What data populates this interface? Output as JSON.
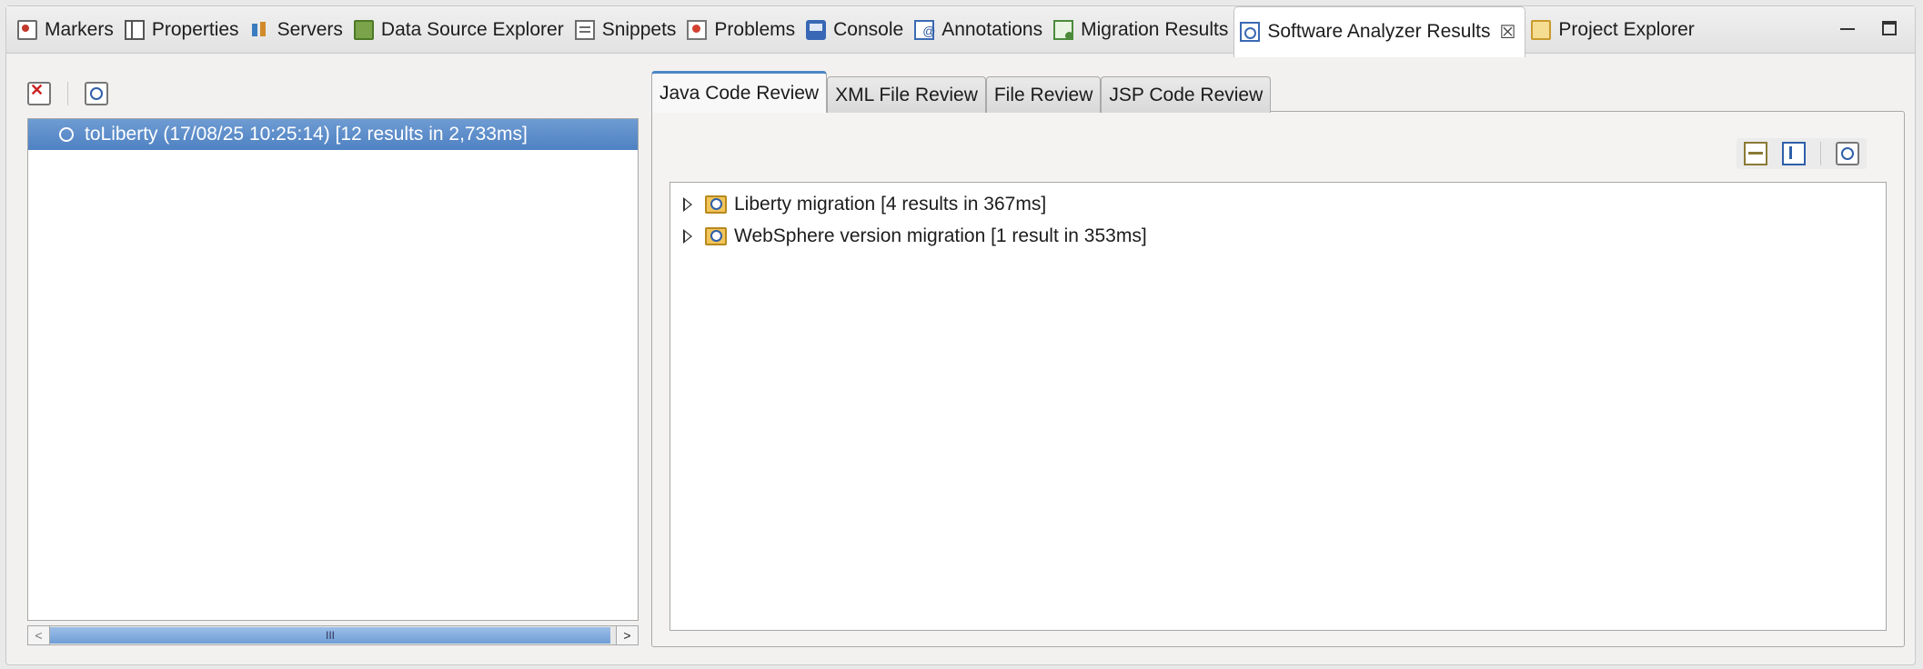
{
  "view_tabs": [
    {
      "label": "Markers",
      "icon": "markers-icon"
    },
    {
      "label": "Properties",
      "icon": "properties-icon"
    },
    {
      "label": "Servers",
      "icon": "servers-icon"
    },
    {
      "label": "Data Source Explorer",
      "icon": "data-source-explorer-icon"
    },
    {
      "label": "Snippets",
      "icon": "snippets-icon"
    },
    {
      "label": "Problems",
      "icon": "problems-icon"
    },
    {
      "label": "Console",
      "icon": "console-icon"
    },
    {
      "label": "Annotations",
      "icon": "annotations-icon"
    },
    {
      "label": "Migration Results",
      "icon": "migration-results-icon"
    },
    {
      "label": "Software Analyzer Results",
      "icon": "software-analyzer-icon",
      "active": true,
      "close_glyph": "☒"
    },
    {
      "label": "Project Explorer",
      "icon": "project-explorer-icon"
    }
  ],
  "history": {
    "rows": [
      {
        "label": "toLiberty (17/08/25 10:25:14)  [12 results in 2,733ms]",
        "selected": true
      }
    ],
    "scroll_thumb_glyph": "III",
    "scroll_left_glyph": "<",
    "scroll_right_glyph": ">"
  },
  "review_tabs": [
    {
      "label": "Java Code Review",
      "active": true
    },
    {
      "label": "XML File Review"
    },
    {
      "label": "File Review"
    },
    {
      "label": "JSP Code Review"
    }
  ],
  "results": [
    {
      "label": "Liberty migration [4 results in 367ms]",
      "expanded": false
    },
    {
      "label": "WebSphere version migration [1 result in 353ms]",
      "expanded": false
    }
  ],
  "colors": {
    "selection": "#5b8ccb",
    "active_tab_accent": "#4d86c6"
  }
}
